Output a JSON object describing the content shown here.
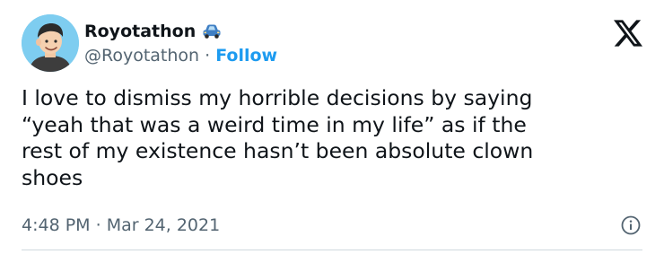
{
  "author": {
    "display_name": "Royotathon",
    "handle": "@Royotathon",
    "separator": " · ",
    "follow_label": "Follow",
    "badge_icon": "car-icon"
  },
  "brand_icon": "x-logo-icon",
  "tweet": {
    "text": "I love to dismiss my horrible decisions by saying\n“yeah that was a weird time in my life” as if the\nrest of my existence hasn’t been absolute clown\nshoes"
  },
  "meta": {
    "time": "4:48 PM",
    "separator": " · ",
    "date": "Mar 24, 2021",
    "info_icon": "info-icon"
  },
  "colors": {
    "text": "#0f1419",
    "secondary": "#536471",
    "accent": "#1d9bf0",
    "divider": "#cfd9de"
  }
}
